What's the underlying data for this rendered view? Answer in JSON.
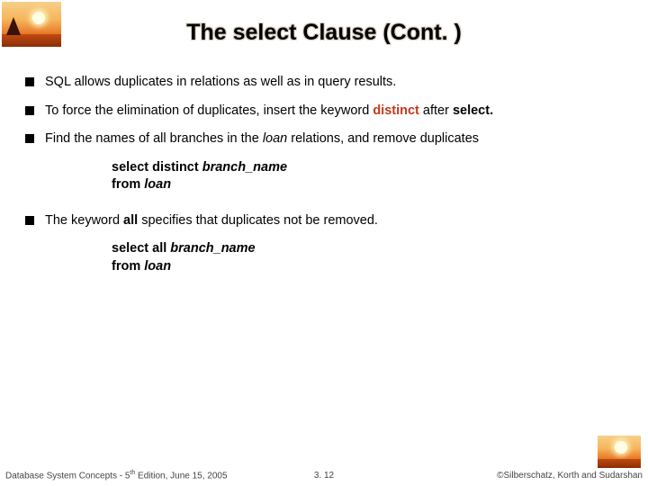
{
  "title": "The select Clause (Cont. )",
  "bullets": {
    "b1": "SQL allows duplicates in relations as well as in query results.",
    "b2_pre": "To force the elimination of duplicates, insert the keyword ",
    "b2_kw": "distinct",
    "b2_post1": "  after ",
    "b2_post2": "select.",
    "b3_pre": "Find the names of all branches in the ",
    "b3_ital": "loan",
    "b3_post": " relations, and remove duplicates",
    "b4_pre": "The keyword ",
    "b4_bold": "all",
    "b4_post": " specifies that duplicates not be removed."
  },
  "code1": {
    "l1a": "select distinct ",
    "l1b": "branch_name",
    "l2a": "from ",
    "l2b": "loan"
  },
  "code2": {
    "l1a": "select all ",
    "l1b": "branch_name",
    "l2a": "from ",
    "l2b": "loan"
  },
  "footer": {
    "left_pre": "Database System Concepts - 5",
    "left_sup": "th",
    "left_post": " Edition, June 15, 2005",
    "center": "3. 12",
    "right": "©Silberschatz, Korth and Sudarshan"
  }
}
